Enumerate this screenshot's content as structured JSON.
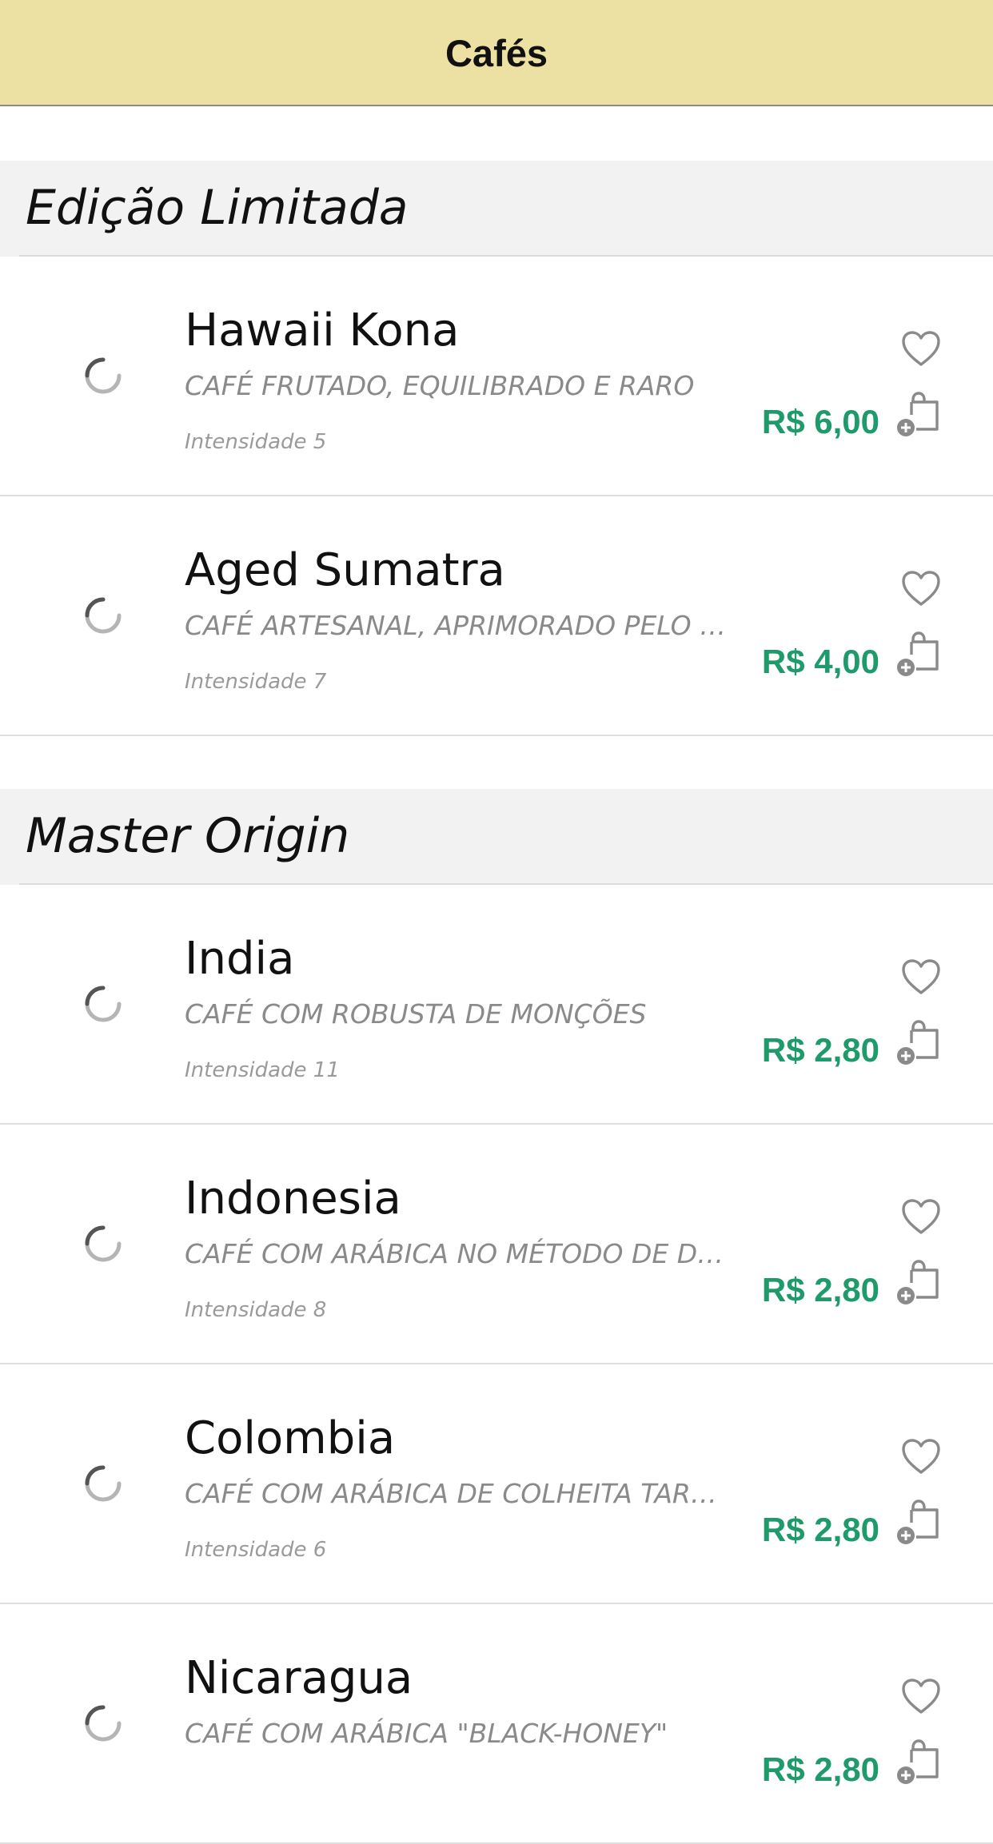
{
  "header": {
    "title": "Cafés"
  },
  "sections": [
    {
      "title": "Edição Limitada",
      "items": [
        {
          "name": "Hawaii Kona",
          "description": "CAFÉ FRUTADO, EQUILIBRADO E RARO",
          "intensity": "Intensidade 5",
          "price": "R$ 6,00"
        },
        {
          "name": "Aged Sumatra",
          "description": "CAFÉ ARTESANAL, APRIMORADO PELO TEMPO",
          "intensity": "Intensidade 7",
          "price": "R$ 4,00"
        }
      ]
    },
    {
      "title": "Master Origin",
      "items": [
        {
          "name": "India",
          "description": "CAFÉ COM ROBUSTA DE MONÇÕES",
          "intensity": "Intensidade 11",
          "price": "R$ 2,80"
        },
        {
          "name": "Indonesia",
          "description": "CAFÉ COM ARÁBICA NO MÉTODO DE DESCASQUE ÚMIDO",
          "intensity": "Intensidade 8",
          "price": "R$ 2,80"
        },
        {
          "name": "Colombia",
          "description": "CAFÉ COM ARÁBICA DE COLHEITA TARDIA",
          "intensity": "Intensidade 6",
          "price": "R$ 2,80"
        },
        {
          "name": "Nicaragua",
          "description": "CAFÉ COM ARÁBICA \"BLACK-HONEY\"",
          "intensity": "",
          "price": "R$ 2,80"
        }
      ]
    }
  ],
  "icons": {
    "favorite": "heart-outline-icon",
    "add_to_cart": "shopping-bag-add-icon",
    "loading": "spinner-icon"
  },
  "colors": {
    "header_bg": "#ece0a3",
    "section_bg": "#f2f2f2",
    "price": "#1f9a6a",
    "icon": "#8a8a8a"
  }
}
